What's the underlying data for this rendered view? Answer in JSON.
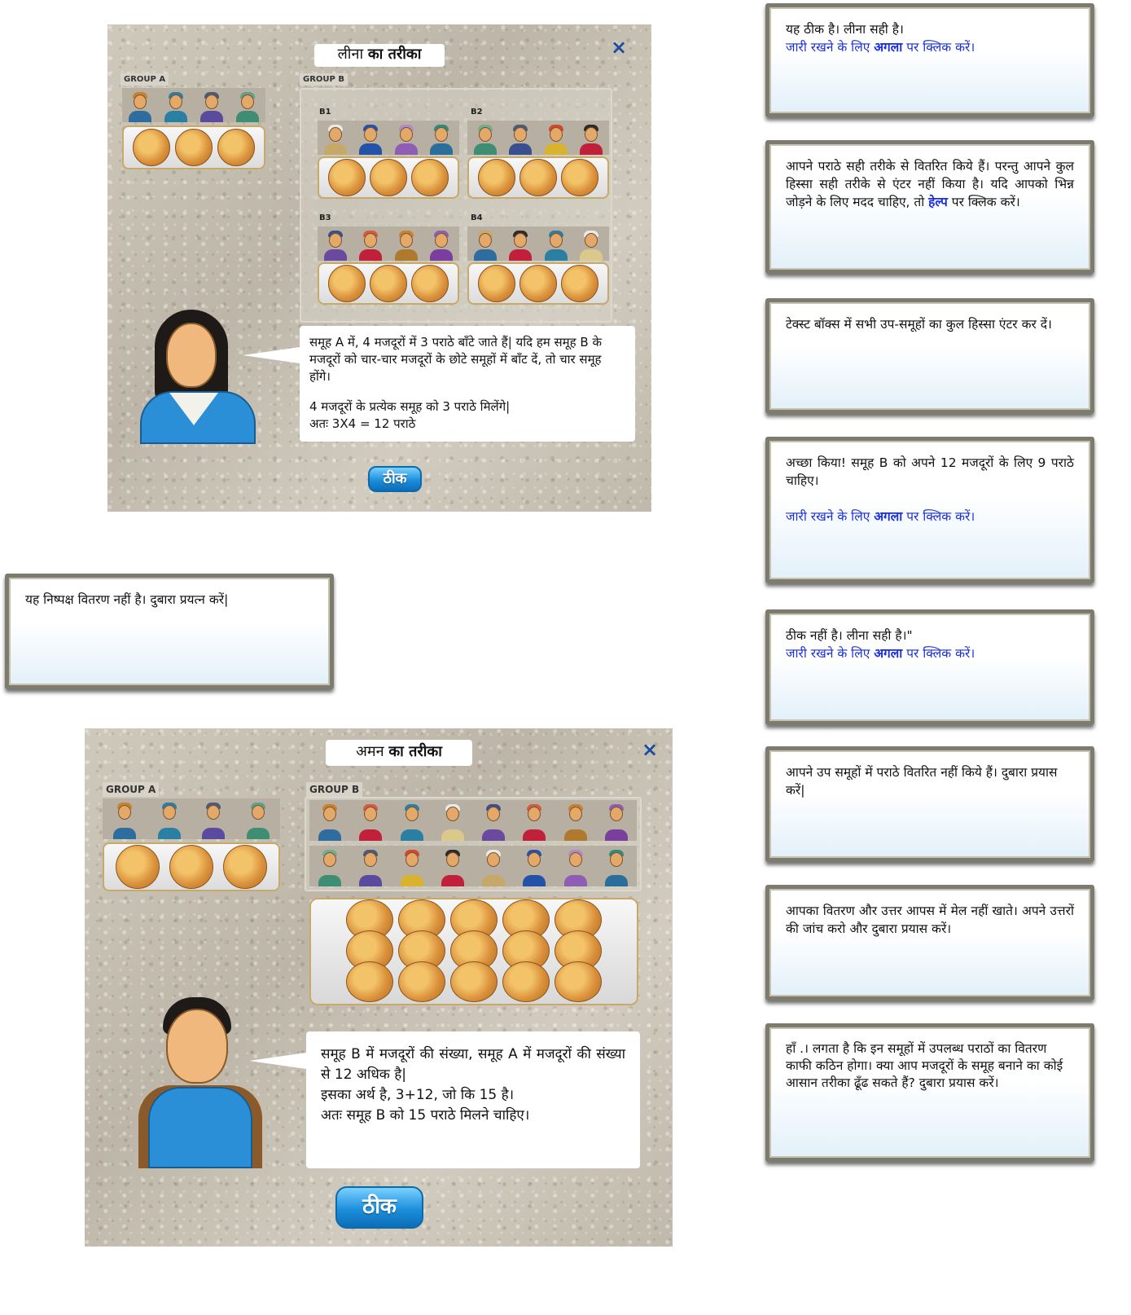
{
  "leena_panel": {
    "title_name": "लीना",
    "title_rest": "का तरीका",
    "close": "×",
    "group_a_label": "GROUP A",
    "group_b_label": "GROUP B",
    "subgroups": [
      "B1",
      "B2",
      "B3",
      "B4"
    ],
    "speech": [
      "समूह A में, 4 मजदूरों में 3 पराठे बाँटे जाते हैं|  यदि हम समूह B के मजदूरों को चार-चार मजदूरों के छोटे  समूहों में बाँट दें, तो चार समूह होंगे।",
      "4 मजदूरों के प्रत्येक समूह को 3 पराठे मिलेंगे|",
      "अतः 3X4 = 12 पराठे"
    ],
    "ok_label": "ठीक"
  },
  "aman_panel": {
    "title_name": "अमन",
    "title_rest": "का तरीका",
    "close": "×",
    "group_a_label": "GROUP A",
    "group_b_label": "GROUP B",
    "speech": [
      "समूह B में मजदूरों की संख्या, समूह A में मजदूरों की संख्या से 12 अधिक है|",
      "इसका अर्थ है, 3+12, जो कि 15 है।",
      "अतः समूह B को 15 पराठे मिलने चाहिए।"
    ],
    "ok_label": "ठीक"
  },
  "left_feedback": {
    "text": "यह निष्पक्ष वितरण नहीं है। दुबारा    प्रयत्न करें|"
  },
  "feedback": [
    {
      "lines": [
        "यह ठीक है।  लीना सही है।"
      ],
      "blue_pre": "जारी रखने के लिए ",
      "blue_bold": "अगला",
      "blue_post": " पर क्लिक करें।"
    },
    {
      "text_pre": "आपने पराठे सही तरीके से वितरित किये हैं। परन्तु आपने कुल हिस्सा सही तरीके से एंटर नहीं किया है।  यदि आपको भिन्न जोड़ने के लिए मदद चाहिए, तो ",
      "help": "हेल्प",
      "text_post": " पर क्लिक करें।"
    },
    {
      "text": "टेक्स्ट बॉक्स में सभी उप-समूहों का कुल हिस्सा एंटर कर दें।"
    },
    {
      "lines": [
        "अच्छा किया! समूह B को अपने 12 मजदूरों के लिए 9 पराठे चाहिए।"
      ],
      "blue_pre": "जारी रखने के लिए ",
      "blue_bold": "अगला",
      "blue_post": " पर क्लिक करें।"
    },
    {
      "lines": [
        "ठीक नहीं है। लीना  सही है।\""
      ],
      "blue_pre": "जारी रखने के लिए ",
      "blue_bold": "अगला",
      "blue_post": " पर क्लिक करें।"
    },
    {
      "text": "आपने उप समूहों में पराठे वितरित नहीं किये हैं। दुबारा प्रयास करें|"
    },
    {
      "text": "आपका वितरण और उत्तर आपस में मेल नहीं खाते। अपने उत्तरों की जांच करो और दुबारा प्रयास करें।"
    },
    {
      "text": "हाँ .। लगता है कि इन समूहों में उपलब्ध पराठों का वितरण काफी कठिन होगा। क्या आप मजदूरों के समूह बनाने का कोई आसान तरीका ढूँढ सकते हैं? दुबारा प्रयास करें।"
    }
  ],
  "colors": {
    "link_blue": "#1a2fe0",
    "button_blue": "#1c8fdc",
    "close_blue": "#1d4e9b"
  }
}
